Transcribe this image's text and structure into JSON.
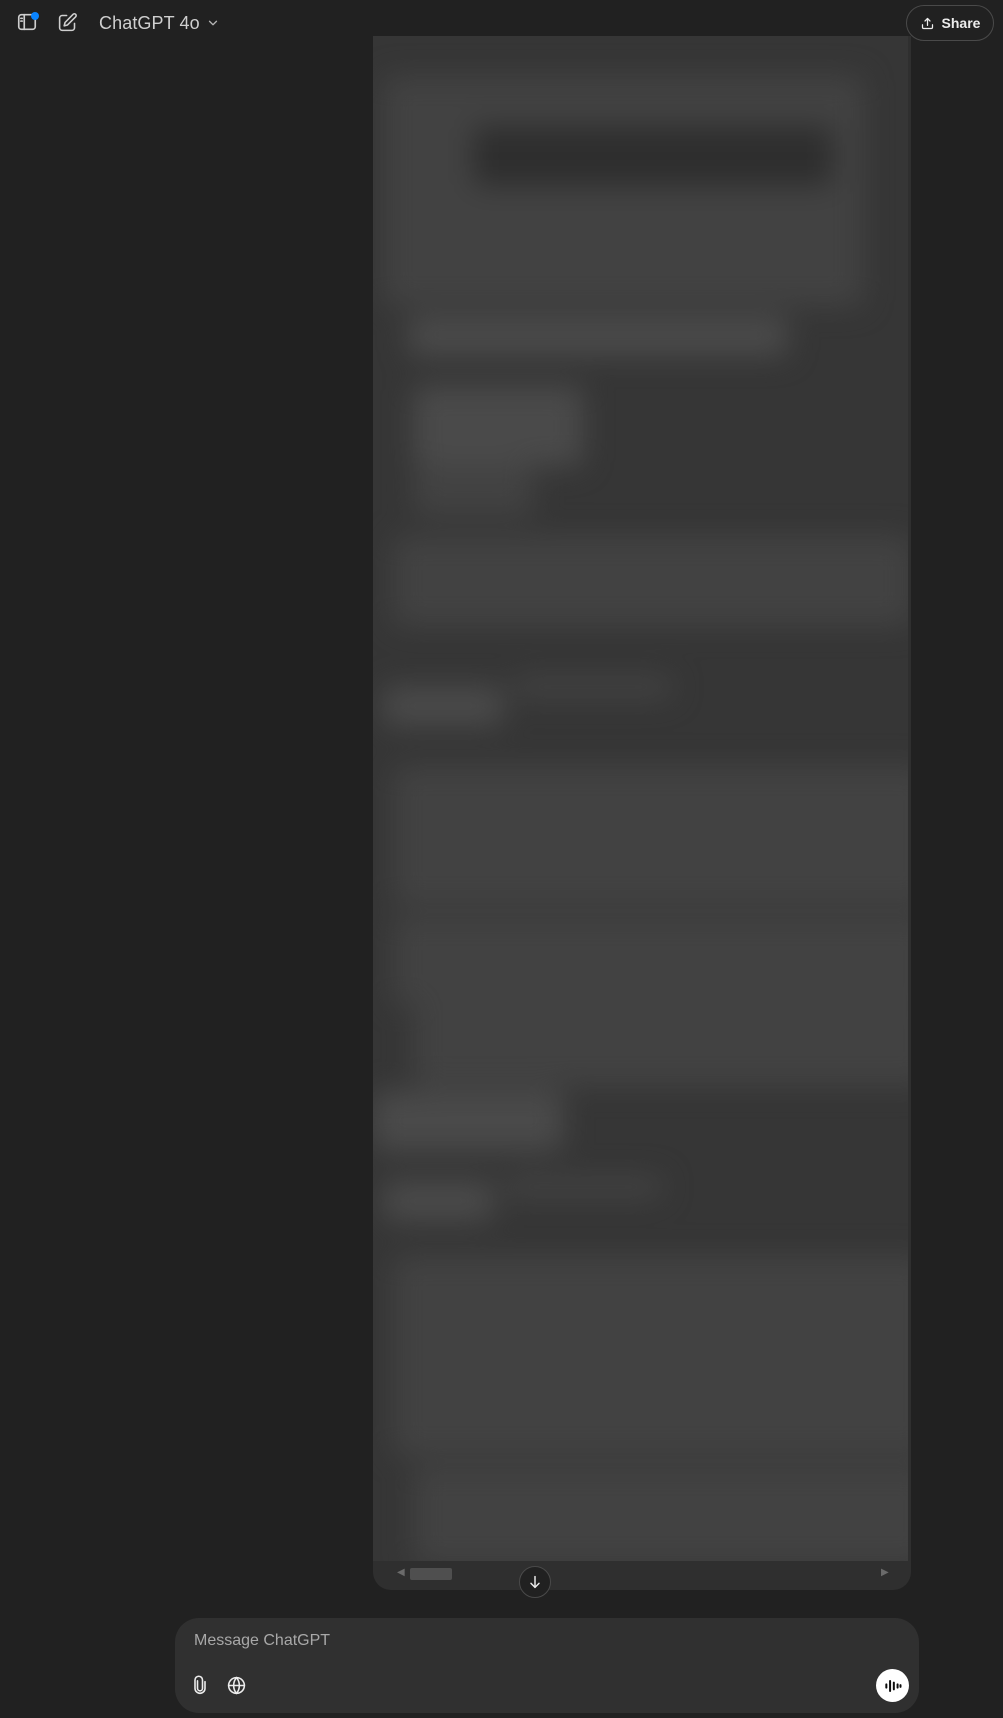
{
  "header": {
    "model_name": "ChatGPT 4o",
    "share_label": "Share",
    "notification_color": "#0a84ff",
    "icons": {
      "sidebar_toggle": "sidebar-toggle-icon",
      "new_chat": "new-chat-icon",
      "model_dropdown": "chevron-down-icon",
      "share": "share-icon"
    }
  },
  "conversation": {
    "content_state": "blurred",
    "scroll_down_icon": "arrow-down-icon"
  },
  "composer": {
    "placeholder": "Message ChatGPT",
    "value": "",
    "icons": {
      "attach": "paperclip-icon",
      "search": "globe-icon",
      "voice": "voice-mode-icon"
    }
  }
}
